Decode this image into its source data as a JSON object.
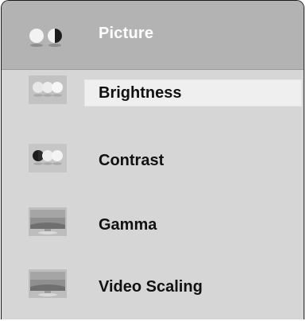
{
  "menu": {
    "header": {
      "title": "Picture",
      "icon": "picture-icon"
    },
    "items": [
      {
        "label": "Brightness",
        "icon": "brightness-icon",
        "selected": true
      },
      {
        "label": "Contrast",
        "icon": "contrast-icon",
        "selected": false
      },
      {
        "label": "Gamma",
        "icon": "gamma-icon",
        "selected": false
      },
      {
        "label": "Video Scaling",
        "icon": "video-scaling-icon",
        "selected": false
      }
    ]
  },
  "colors": {
    "panel_background": "#d6d6d6",
    "header_background": "#b3b3b3",
    "selected_highlight": "#efefef",
    "border": "#1a1a1a"
  }
}
